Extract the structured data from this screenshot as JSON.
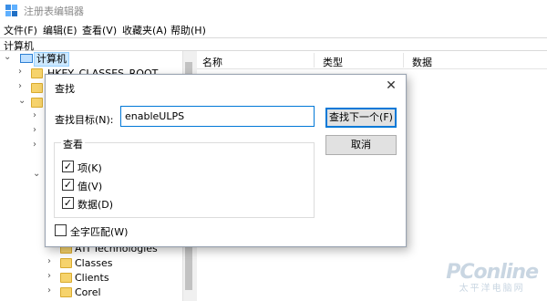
{
  "app": {
    "title": "注册表编辑器",
    "icon": "registry-editor-icon"
  },
  "menu": [
    {
      "label": "文件(F)"
    },
    {
      "label": "编辑(E)"
    },
    {
      "label": "查看(V)"
    },
    {
      "label": "收藏夹(A)"
    },
    {
      "label": "帮助(H)"
    }
  ],
  "address": "计算机",
  "tree": {
    "root": "计算机",
    "items": [
      {
        "label": "HKEY_CLASSES_ROOT"
      },
      {
        "label": "ATI Technologies"
      },
      {
        "label": "Classes"
      },
      {
        "label": "Clients"
      },
      {
        "label": "Corel"
      }
    ]
  },
  "list": {
    "columns": [
      "名称",
      "类型",
      "数据"
    ]
  },
  "dialog": {
    "title": "查找",
    "close_glyph": "✕",
    "find_label": "查找目标(N):",
    "find_value": "enableULPS",
    "find_next_button": "查找下一个(F)",
    "cancel_button": "取消",
    "look_at": {
      "title": "查看",
      "keys": {
        "label": "项(K)",
        "checked": true
      },
      "values": {
        "label": "值(V)",
        "checked": true
      },
      "data": {
        "label": "数据(D)",
        "checked": true
      }
    },
    "match_whole": {
      "label": "全字匹配(W)",
      "checked": false
    }
  },
  "watermark": {
    "main": "PConline",
    "sub": "太平洋电脑网"
  },
  "colors": {
    "accent": "#0078d7",
    "folder": "#f6d36c",
    "selection": "#cce8ff"
  }
}
